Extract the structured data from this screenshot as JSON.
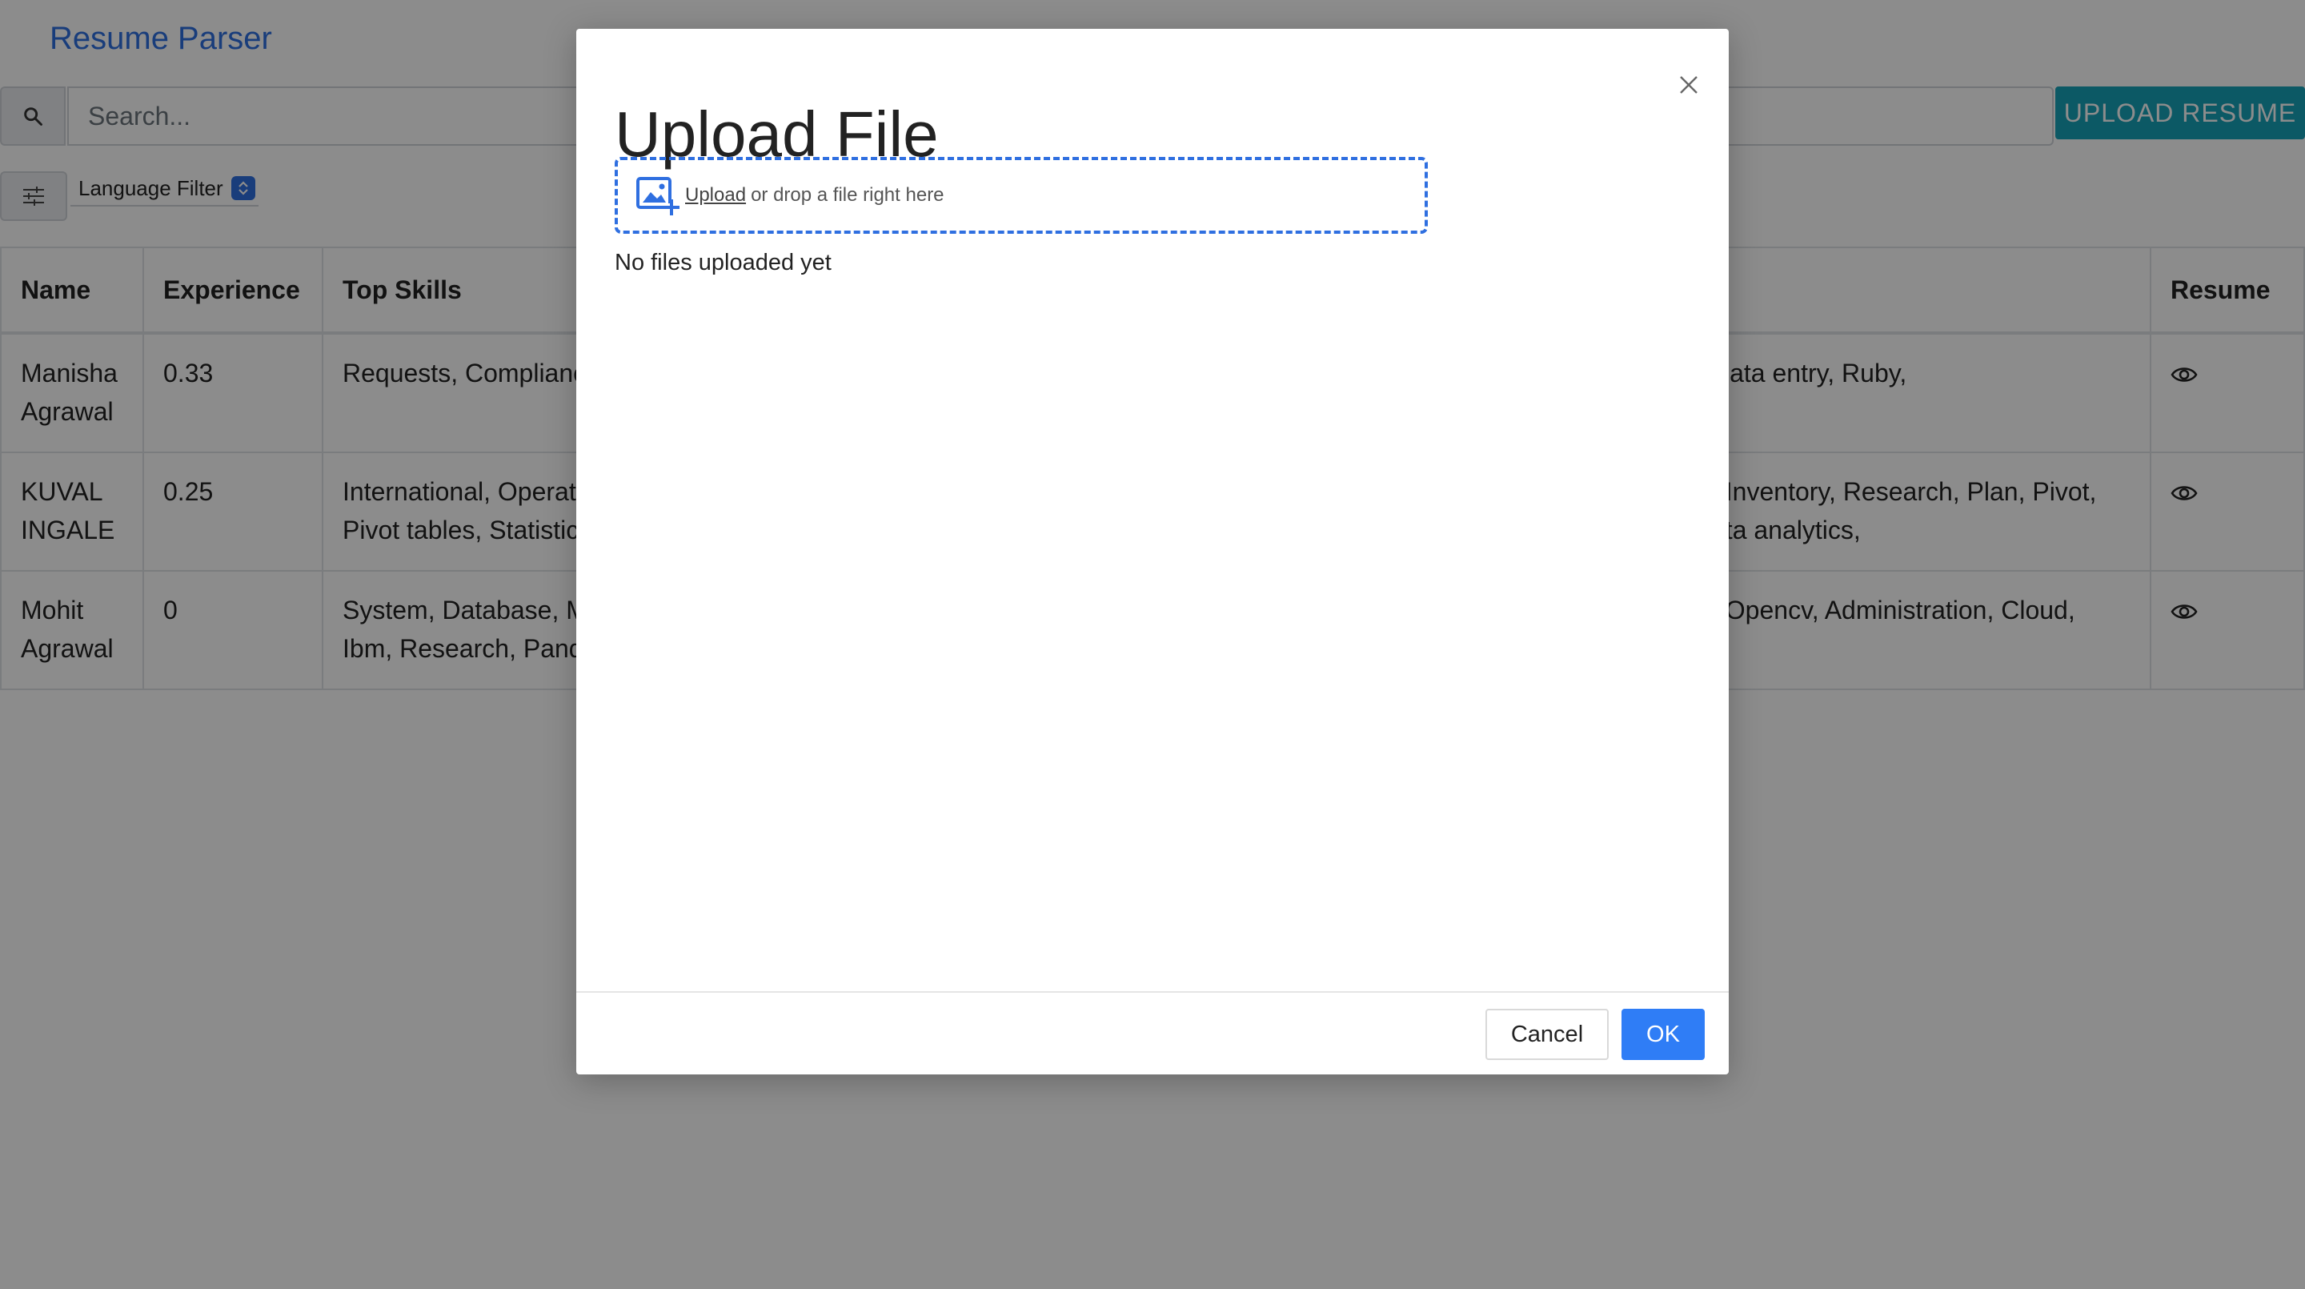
{
  "app": {
    "brand": "Resume Parser"
  },
  "toolbar": {
    "search_placeholder": "Search...",
    "upload_resume_label": "UPLOAD RESUME",
    "language_filter_label": "Language Filter"
  },
  "table": {
    "headers": {
      "name": "Name",
      "experience": "Experience",
      "skills": "Top Skills",
      "resume": "Resume"
    },
    "rows": [
      {
        "name": "Manisha Agrawal",
        "experience": "0.33",
        "skills": "Requests, Complianc",
        "skills_right": "Data entry, Ruby,"
      },
      {
        "name": "KUVAL INGALE",
        "experience": "0.25",
        "skills": "International, Operat\nPivot tables, Statistic",
        "skills_right": ", Inventory, Research, Plan, Pivot,\nata analytics,"
      },
      {
        "name": "Mohit Agrawal",
        "experience": "0",
        "skills": "System, Database, M\nIbm, Research, Pand",
        "skills_right": ", Opencv, Administration, Cloud,"
      }
    ]
  },
  "modal": {
    "title": "Upload File",
    "dropzone_link": "Upload",
    "dropzone_text": "or drop a file right here",
    "status": "No files uploaded yet",
    "cancel_label": "Cancel",
    "ok_label": "OK"
  },
  "icons": {
    "search": "search-icon",
    "filter": "sliders-icon",
    "select": "select-arrows-icon",
    "eye": "eye-icon",
    "close": "close-icon",
    "add_image": "add-image-icon"
  },
  "colors": {
    "accent": "#2f6fe0",
    "upload_button": "#17a2b8",
    "ok_button": "#2f7df6",
    "overlay": "rgba(0,0,0,0.45)"
  }
}
